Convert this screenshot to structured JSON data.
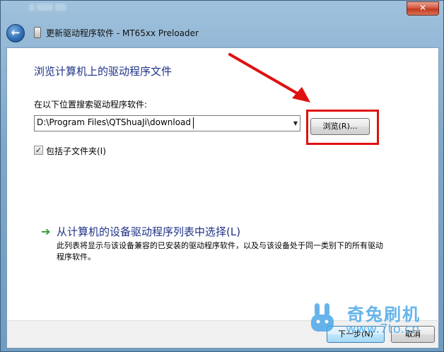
{
  "window": {
    "title": "更新驱动程序软件 - MT65xx Preloader",
    "close_glyph": "✕",
    "back_glyph": "←"
  },
  "main": {
    "heading": "浏览计算机上的驱动程序文件",
    "search_label": "在以下位置搜索驱动程序软件:",
    "path_value": "D:\\Program Files\\QTShuaJi\\download",
    "combo_arrow_glyph": "▼",
    "browse_label": "浏览(R)...",
    "include_subfolders": {
      "checked": true,
      "check_glyph": "✓",
      "label": "包括子文件夹(I)"
    },
    "pick_option": {
      "arrow_glyph": "➔",
      "title": "从计算机的设备驱动程序列表中选择(L)",
      "description": "此列表将显示与该设备兼容的已安装的驱动程序软件，以及与该设备处于同一类别下的所有驱动程序软件。"
    }
  },
  "footer": {
    "next_label": "下一步(N)",
    "cancel_label": "取消"
  },
  "watermark": {
    "name": "奇兔刷机",
    "url": "www.7to.cn"
  },
  "colors": {
    "heading": "#1e3287",
    "highlight": "#e01010",
    "watermark": "#4ca8e8"
  }
}
